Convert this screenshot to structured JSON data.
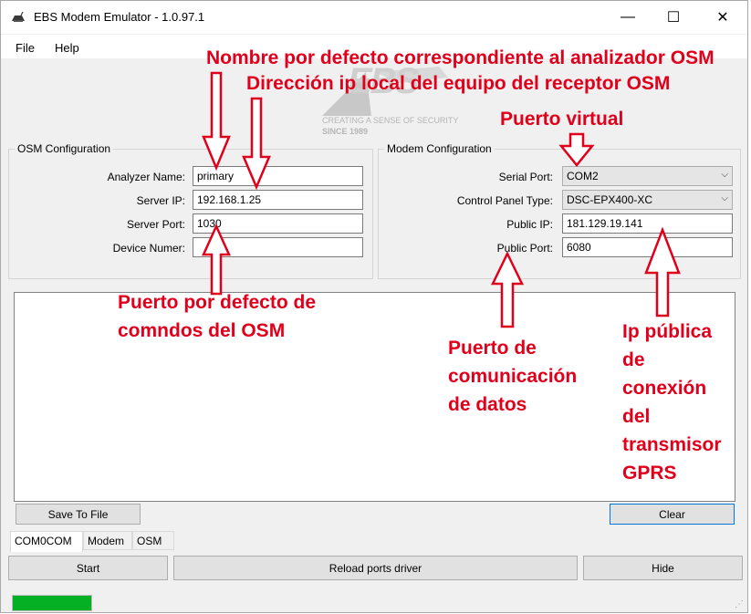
{
  "window": {
    "title": "EBS Modem Emulator - 1.0.97.1",
    "minimize_glyph": "—",
    "maximize_glyph": "☐",
    "close_glyph": "✕"
  },
  "menu": {
    "file": "File",
    "help": "Help"
  },
  "logo": {
    "brand": "EBS",
    "tagline": "CREATING A SENSE OF SECURITY",
    "since": "SINCE 1989"
  },
  "osm_config": {
    "title": "OSM Configuration",
    "analyzer_name_label": "Analyzer Name:",
    "analyzer_name_value": "primary",
    "server_ip_label": "Server IP:",
    "server_ip_value": "192.168.1.25",
    "server_port_label": "Server Port:",
    "server_port_value": "1030",
    "device_number_label": "Device Numer:",
    "device_number_value": ""
  },
  "modem_config": {
    "title": "Modem Configuration",
    "serial_port_label": "Serial Port:",
    "serial_port_value": "COM2",
    "control_panel_label": "Control Panel Type:",
    "control_panel_value": "DSC-EPX400-XC",
    "public_ip_label": "Public IP:",
    "public_ip_value": "181.129.19.141",
    "public_port_label": "Public Port:",
    "public_port_value": "6080"
  },
  "buttons": {
    "save_to_file": "Save To File",
    "clear": "Clear",
    "start": "Start",
    "reload_ports_driver": "Reload ports driver",
    "hide": "Hide"
  },
  "tabs": [
    "COM0COM",
    "Modem",
    "OSM"
  ],
  "progress": {
    "value": 1.0,
    "color": "#06b025"
  },
  "annotations": {
    "default_name": "Nombre por defecto correspondiente al analizador OSM",
    "local_ip": "Dirección ip local del equipo del receptor OSM",
    "virtual_port": "Puerto virtual",
    "default_port": "Puerto por defecto de\ncomndos del OSM",
    "data_port": "Puerto de\ncomunicación\nde datos",
    "public_ip": "Ip pública\nde\nconexión\ndel\ntransmisor\nGPRS",
    "color": "#e0001b"
  }
}
